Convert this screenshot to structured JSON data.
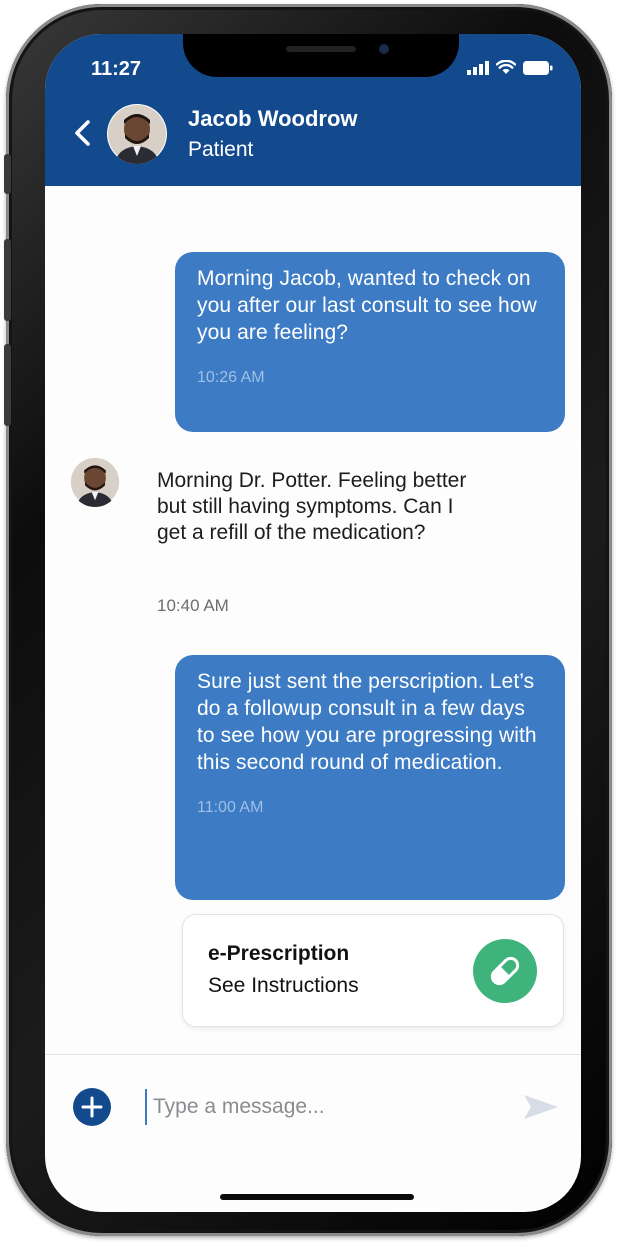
{
  "status_bar": {
    "time": "11:27"
  },
  "header": {
    "contact_name": "Jacob Woodrow",
    "contact_role": "Patient"
  },
  "messages": [
    {
      "direction": "outgoing",
      "text": "Morning Jacob, wanted to check on you after our last consult to see how you are feeling?",
      "time": "10:26 AM"
    },
    {
      "direction": "incoming",
      "text": "Morning Dr. Potter. Feeling better but still having symptoms. Can I get a refill of the medication?",
      "time": "10:40 AM"
    },
    {
      "direction": "outgoing",
      "text": "Sure just sent the perscription. Let’s do a followup consult in a few days to see how you are progressing with this second round of medication.",
      "time": "11:00 AM"
    }
  ],
  "prescription_card": {
    "title": "e-Prescription",
    "subtitle": "See Instructions",
    "icon": "pill-icon"
  },
  "composer": {
    "placeholder": "Type a message...",
    "add_icon": "plus-icon",
    "send_icon": "send-icon"
  },
  "colors": {
    "header": "#134a8e",
    "outgoing_bubble": "#3d7cc4",
    "pill_button": "#3eb37b"
  }
}
